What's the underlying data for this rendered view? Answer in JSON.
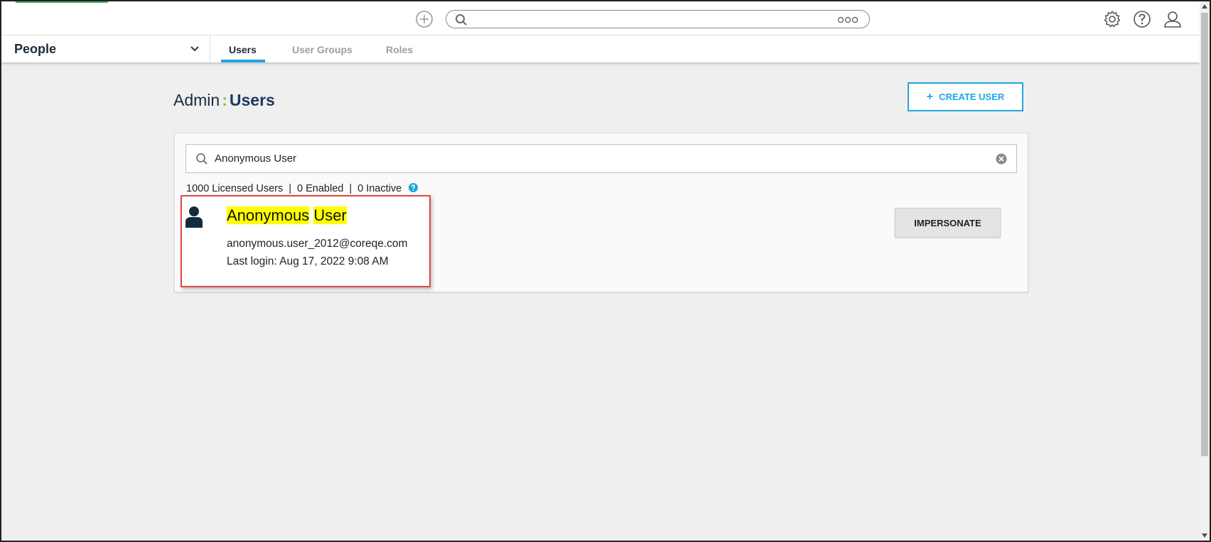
{
  "subnav": {
    "module": "People",
    "tabs": [
      {
        "label": "Users"
      },
      {
        "label": "User Groups"
      },
      {
        "label": "Roles"
      }
    ]
  },
  "page": {
    "title_prefix": "Admin",
    "title_sep": ":",
    "title_main": "Users",
    "create_label": "CREATE USER"
  },
  "search": {
    "value": "Anonymous User"
  },
  "counts": {
    "licensed": "1000 Licensed Users",
    "sep": "|",
    "enabled": "0 Enabled",
    "inactive": "0 Inactive"
  },
  "user": {
    "first_name": "Anonymous",
    "last_name": "User",
    "email": "anonymous.user_2012@coreqe.com",
    "last_login": "Last login: Aug 17, 2022 9:08 AM",
    "impersonate_label": "IMPERSONATE"
  },
  "colors": {
    "accent": "#1fa6e0",
    "highlight": "#ffff00",
    "callout": "#e04848",
    "colon": "#7cc242"
  },
  "icons": [
    "add-circle-icon",
    "search-icon",
    "more-icon",
    "gear-icon",
    "help-icon",
    "profile-icon",
    "chevron-down-icon",
    "plus-icon",
    "clear-icon",
    "info-icon",
    "person-icon"
  ]
}
